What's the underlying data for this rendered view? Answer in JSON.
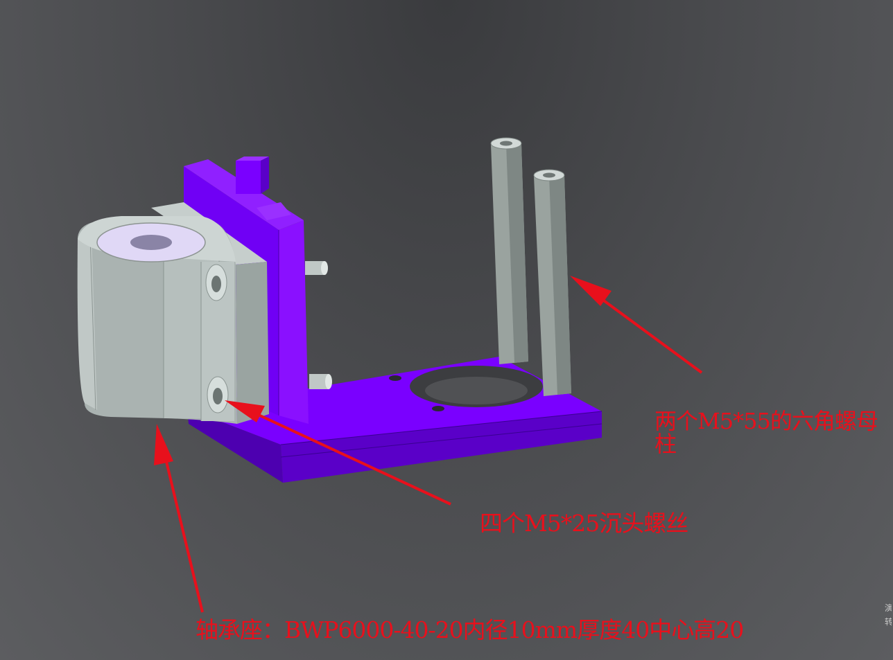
{
  "annotations": {
    "hex_standoffs": "两个M5*55的六角螺母柱",
    "countersunk_screws": "四个M5*25沉头螺丝",
    "bearing_block": "轴承座：BWP6000-40-20内径10mm厚度40中心高20"
  },
  "edge_text": [
    "演",
    "转"
  ],
  "colors": {
    "background": "#4a4b4e",
    "bracket_purple": "#7800ff",
    "bearing_gray": "#a9b3b0",
    "standoff_gray": "#9aa39f",
    "annotation_red": "#e8101c"
  }
}
